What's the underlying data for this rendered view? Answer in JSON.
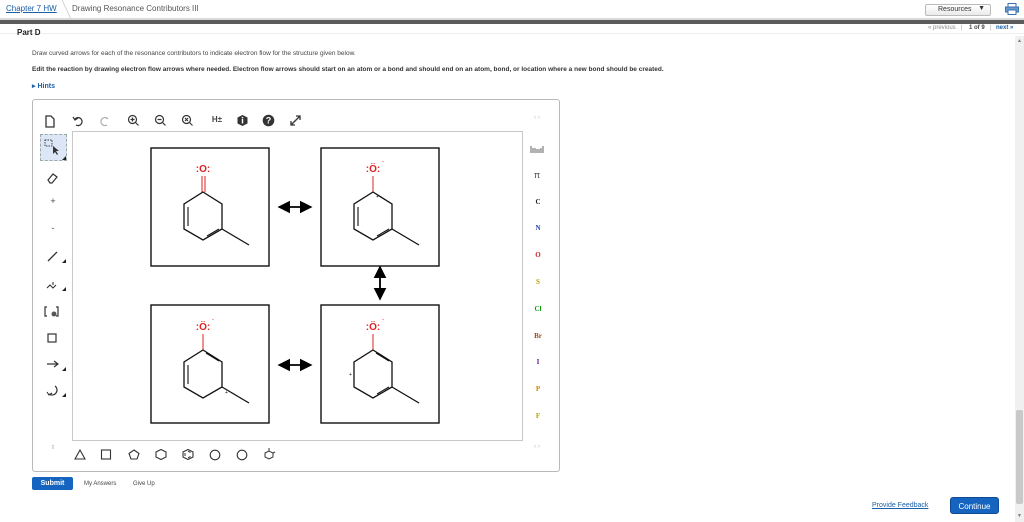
{
  "topbar": {
    "breadcrumb_chapter": "Chapter 7 HW",
    "breadcrumb_title": "Drawing Resonance Contributors III",
    "resources_label": "Resources"
  },
  "pager": {
    "previous": "« previous",
    "count": "1 of 9",
    "next": "next »"
  },
  "part_title": "Part D",
  "instructions": "Draw curved arrows for each of the resonance contributors to indicate electron flow for the structure given below.",
  "instructions_bold": "Edit the reaction by drawing electron flow arrows where needed. Electron flow arrows should start on an atom or a bond and should end on an atom, bond, or location where a new bond should be created.",
  "hints_label": "Hints",
  "toolbar": {
    "h_label": "H±"
  },
  "left_tools": {
    "plus": "+",
    "minus": "-"
  },
  "elements": {
    "list": [
      "C",
      "N",
      "O",
      "S",
      "Cl",
      "Br",
      "I",
      "P",
      "F"
    ],
    "colors": [
      "#222222",
      "#1f3fa8",
      "#d32020",
      "#b8a000",
      "#119911",
      "#a0461e",
      "#6a2090",
      "#d08000",
      "#b8a000"
    ]
  },
  "molecules": {
    "oxygen_label": ":O:",
    "oxygen_label_neg": ":Ö:",
    "plus_sign": "+",
    "minus_sign": "-"
  },
  "actions": {
    "submit": "Submit",
    "my_answers": "My Answers",
    "give_up": "Give Up",
    "provide_feedback": "Provide Feedback",
    "continue": "Continue"
  },
  "colors": {
    "accent": "#1565c0",
    "link": "#1a5fa8",
    "oxygen": "#e02020",
    "selection_bg": "#dde6f6"
  }
}
